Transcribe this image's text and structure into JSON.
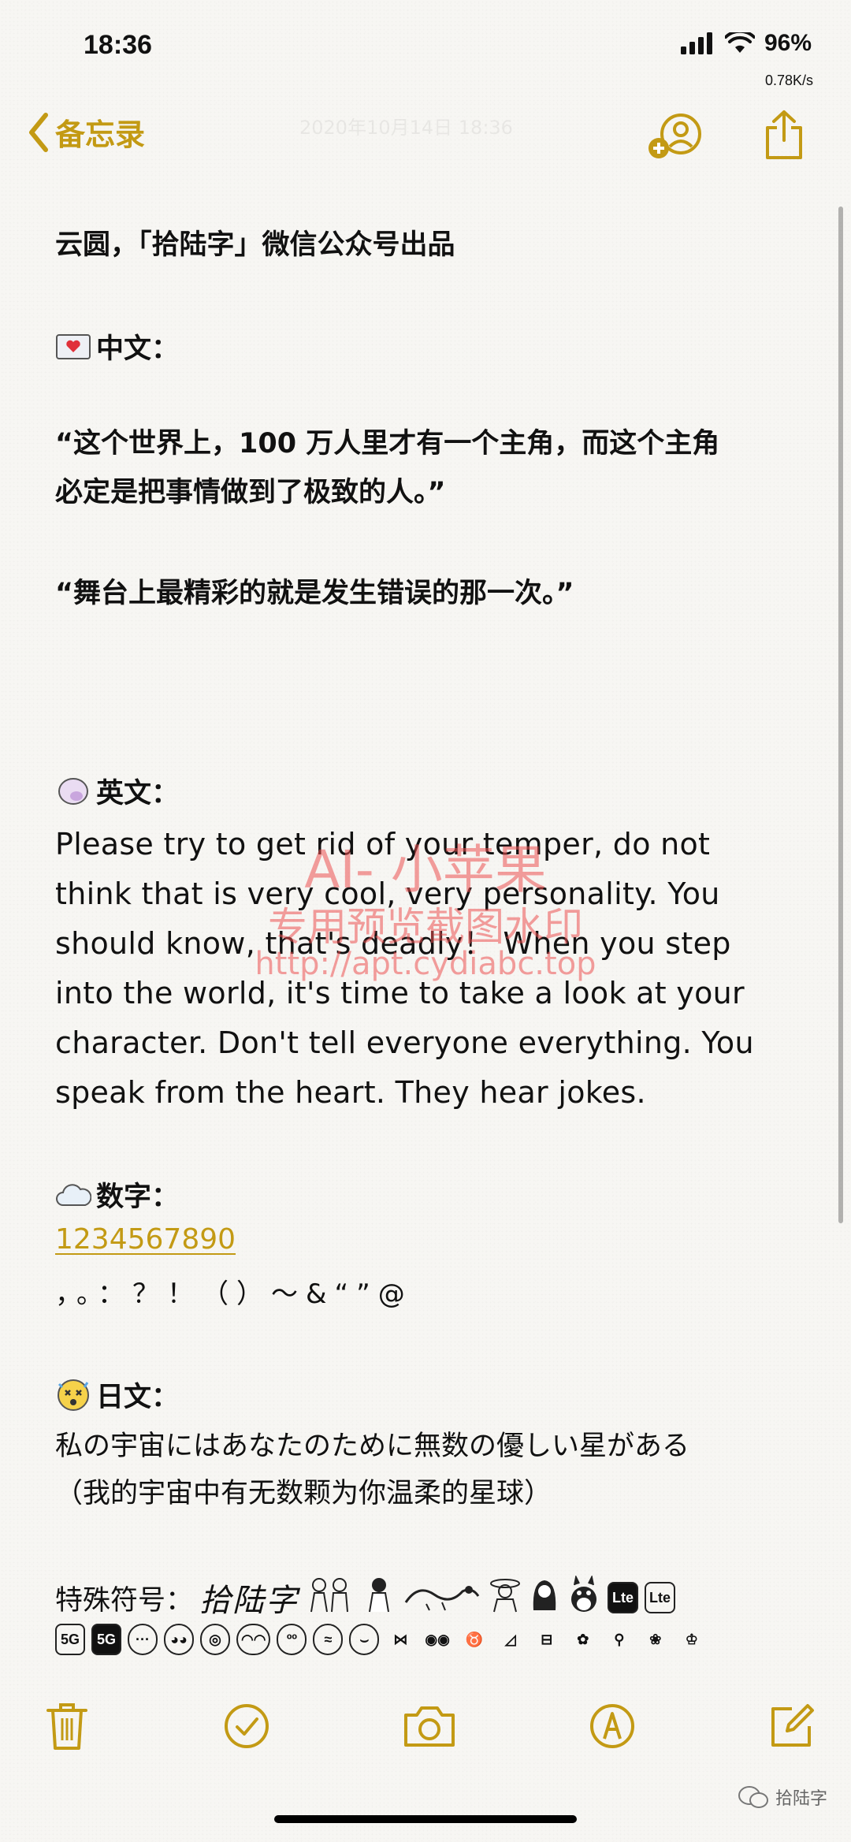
{
  "status": {
    "time": "18:36",
    "battery": "96%",
    "net_speed": "0.78K/s"
  },
  "nav": {
    "back_label": "备忘录",
    "ghost_date": "2020年10月14日 18:36"
  },
  "note": {
    "title": "云圆，「拾陆字」微信公众号出品",
    "zh_header": "中文：",
    "zh_quote1_line1": "“这个世界上，100 万人里才有一个主角，而这个主角",
    "zh_quote1_line2": "必定是把事情做到了极致的人。”",
    "zh_quote2": "“舞台上最精彩的就是发生错误的那一次。”",
    "en_header": "英文：",
    "en_lines": [
      "Please try to get rid of your temper, do not",
      "think that is very cool, very personality. You",
      "should know, that's deadly！ When you step",
      "into the world, it's time to take a look at your",
      "character. Don't tell everyone everything. You",
      "speak from the heart. They hear jokes."
    ],
    "num_header": "数字：",
    "digits": "1234567890",
    "punct": "，。：？！（）～&“”@",
    "ja_header": "日文：",
    "ja_line": "私の宇宙にはあなたのために無数の優しい星がある",
    "ja_translation": "（我的宇宙中有无数颗为你温柔的星球）",
    "special_header": "特殊符号：",
    "special_sig": "拾陆字",
    "special_badges": [
      "Lte",
      "Lte",
      "5G",
      "5G"
    ]
  },
  "watermark": {
    "line1": "AI- 小苹果",
    "line2": "专用预览截图水印",
    "line3": "http://apt.cydiabc.top"
  },
  "footer": {
    "wechat_label": "拾陆字"
  },
  "colors": {
    "accent": "#c39a14",
    "watermark": "#ec5050"
  },
  "icons": [
    "chevron-left-icon",
    "add-person-icon",
    "share-icon",
    "trash-icon",
    "checklist-icon",
    "camera-icon",
    "markup-icon",
    "compose-icon"
  ]
}
